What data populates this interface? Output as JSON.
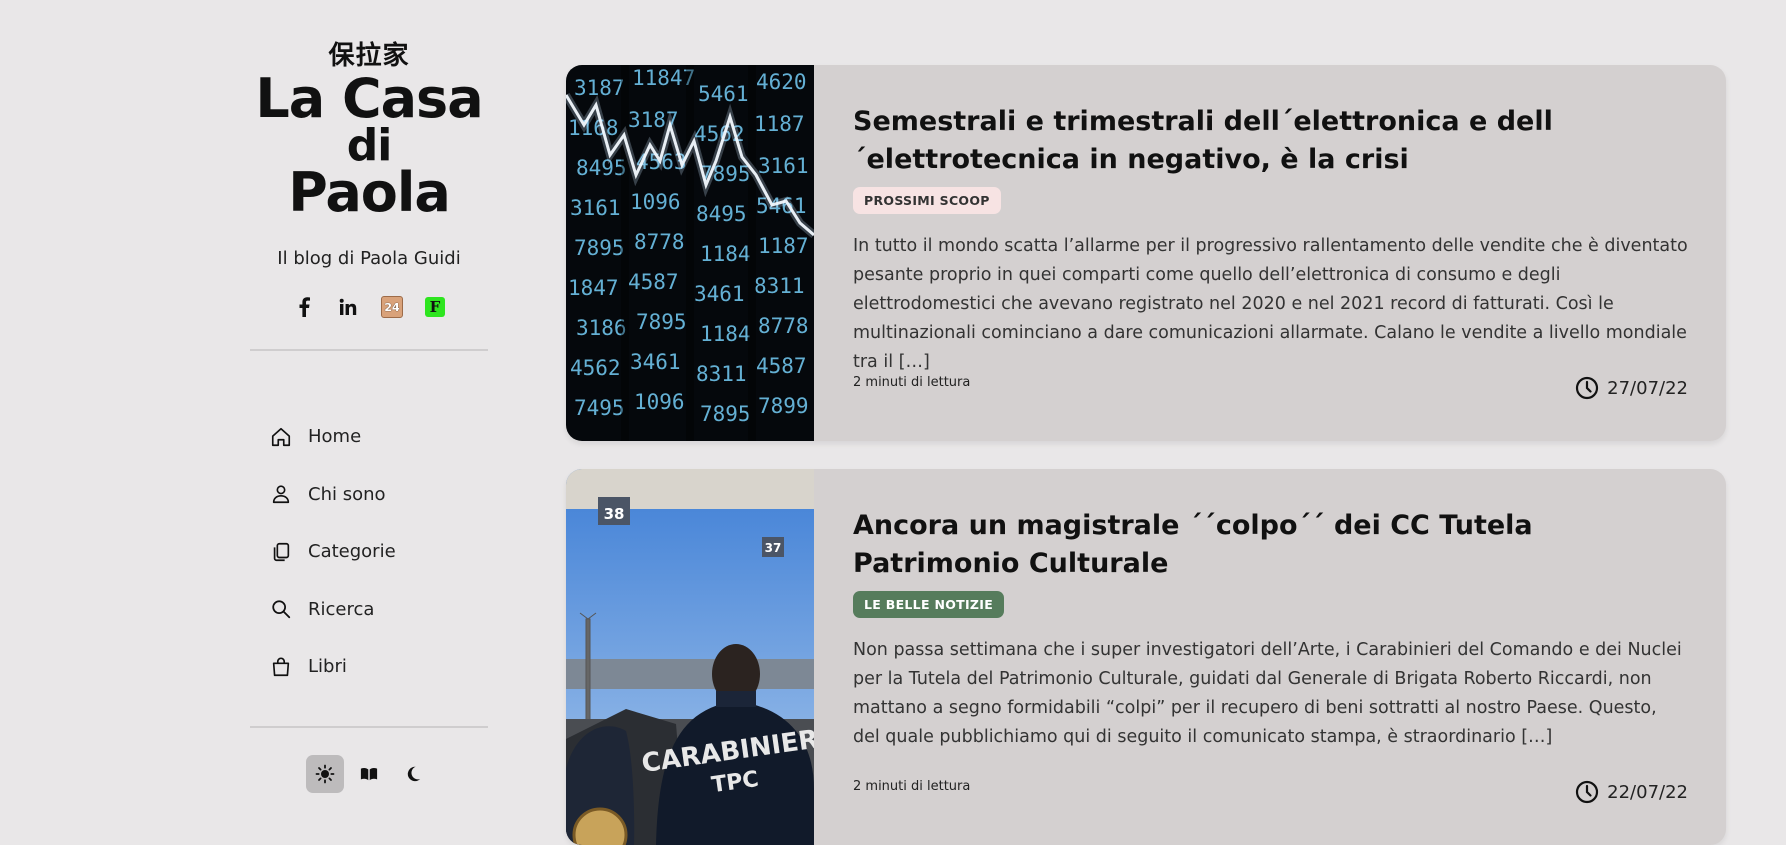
{
  "site": {
    "kanji": "保拉家",
    "title_line1": "La Casa",
    "title_line2": "di",
    "title_line3": "Paola",
    "tagline": "Il blog di Paola Guidi",
    "social": [
      {
        "icon": "facebook-icon"
      },
      {
        "icon": "linkedin-icon"
      },
      {
        "icon": "sole24ore-icon",
        "label": "24"
      },
      {
        "icon": "f-icon",
        "label": "F"
      }
    ]
  },
  "nav": {
    "items": [
      {
        "label": "Home",
        "icon": "home-icon"
      },
      {
        "label": "Chi sono",
        "icon": "user-icon"
      },
      {
        "label": "Categorie",
        "icon": "copy-icon"
      },
      {
        "label": "Ricerca",
        "icon": "search-icon"
      },
      {
        "label": "Libri",
        "icon": "bag-icon"
      }
    ]
  },
  "theme": {
    "options": [
      "light",
      "reader",
      "dark"
    ],
    "active": "light"
  },
  "posts": [
    {
      "title": "Semestrali e trimestrali dell´elettronica e dell´elettrotecnica in negativo, è la crisi",
      "category": "PROSSIMI SCOOP",
      "excerpt": "In tutto il mondo scatta l’allarme per il progressivo rallentamento delle vendite che è diventato pesante proprio in quei comparti come quello dell’elettronica di consumo e degli elettrodomestici che avevano registrato nel 2020 e nel 2021 record di fatturati. Così le multinazionali cominciano a dare comunicazioni allarmate. Calano le vendite a livello mondiale tra il […]",
      "readtime": "2 minuti di lettura",
      "date": "27/07/22",
      "badge_color": "#f7e3e3"
    },
    {
      "title": "Ancora un magistrale ´´colpo´´ dei CC Tutela Patrimonio Culturale",
      "category": "LE BELLE NOTIZIE",
      "excerpt": "Non passa settimana che i super investigatori dell’Arte, i Carabinieri del Comando e dei Nuclei per la Tutela del Patrimonio Culturale, guidati dal Generale di Brigata Roberto Riccardi, non mattano a segno formidabili “colpi” per il recupero di beni sottratti al nostro Paese. Questo, del quale pubblichiamo qui di seguito il comunicato stampa, è straordinario […]",
      "readtime": "2 minuti di lettura",
      "date": "22/07/22",
      "badge_color": "#567c5c",
      "image_text_back": "CARABINIERI",
      "image_text_sub": "TPC",
      "gate_numbers": [
        "38",
        "37"
      ]
    }
  ]
}
